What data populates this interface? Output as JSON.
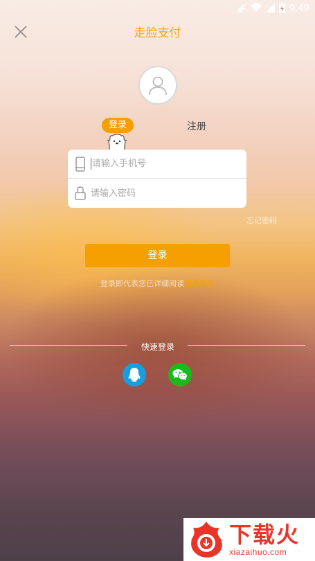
{
  "status_bar": {
    "time": "9:49"
  },
  "header": {
    "title": "走脸支付"
  },
  "tabs": {
    "login": "登录",
    "register": "注册"
  },
  "form": {
    "phone_placeholder": "请输入手机号",
    "password_placeholder": "请输入密码"
  },
  "forgot_password": "忘记密码",
  "login_button": "登录",
  "terms": {
    "prefix": "登录即代表您已详细阅读",
    "link": "服务条款"
  },
  "quick_login": {
    "title": "快速登录"
  },
  "watermark": {
    "cn": "下载火",
    "en": "xiazaihuo.com"
  },
  "colors": {
    "accent": "#f5a000",
    "qq": "#1a9de0",
    "wechat": "#1db81d"
  }
}
